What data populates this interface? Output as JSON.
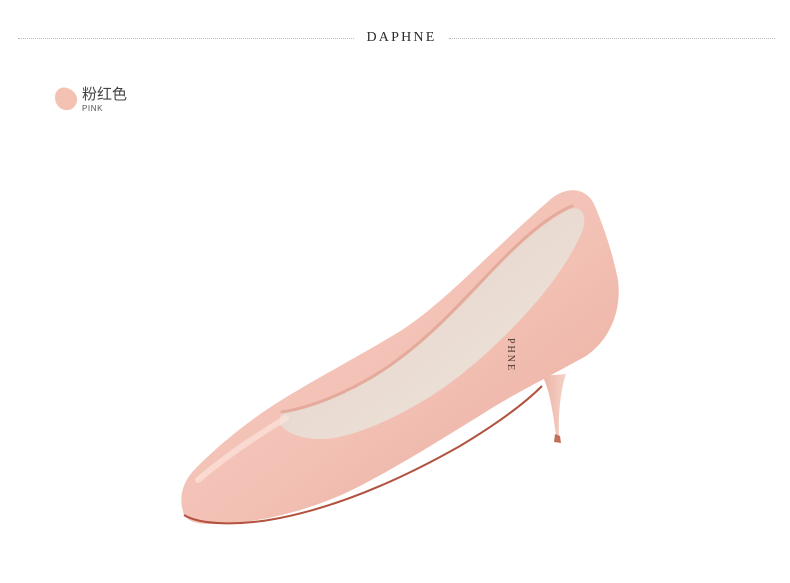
{
  "header": {
    "brand": "DAPHNE"
  },
  "color_swatch": {
    "label_cn": "粉红色",
    "label_en": "PINK",
    "swatch_color": "#f3c2b2"
  },
  "product": {
    "insole_print": "PHNE",
    "upper_color": "#f4c3b8",
    "lining_color": "#e9dcd2",
    "sole_edge_color": "#b2523f"
  }
}
